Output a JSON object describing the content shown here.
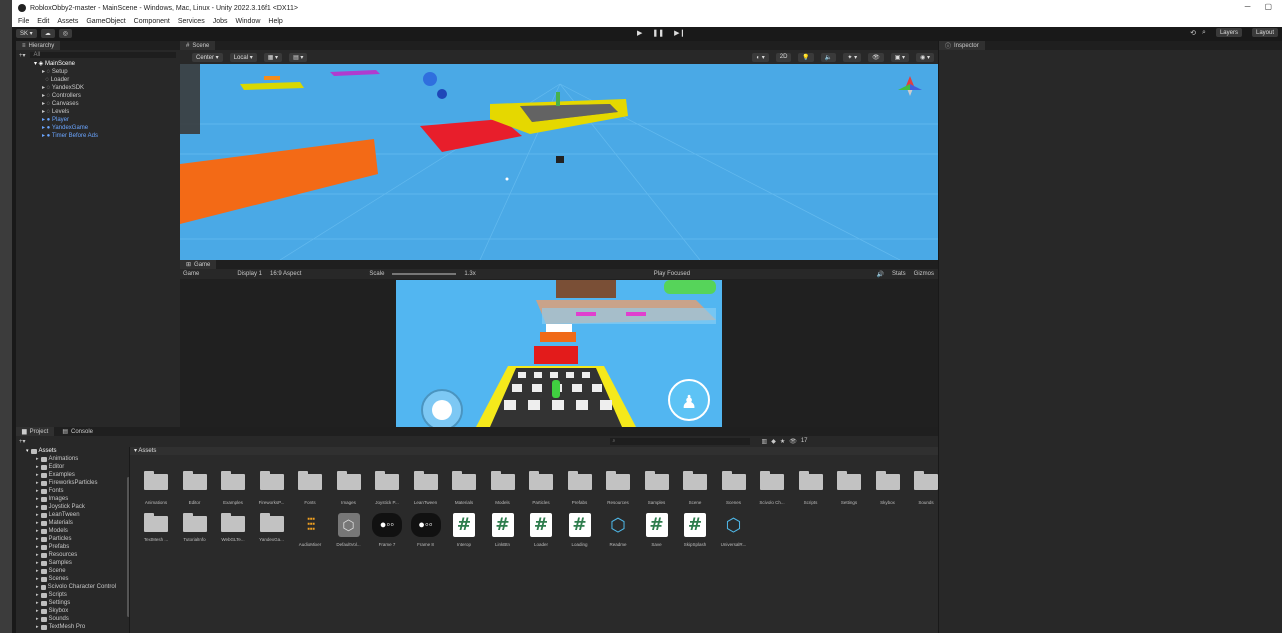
{
  "window": {
    "title": "RobloxObby2-master - MainScene - Windows, Mac, Linux - Unity 2022.3.16f1 <DX11>"
  },
  "menu": [
    "File",
    "Edit",
    "Assets",
    "GameObject",
    "Component",
    "Services",
    "Jobs",
    "Window",
    "Help"
  ],
  "toolbar": {
    "account": "SK ▾",
    "layers": "Layers",
    "layout": "Layout"
  },
  "hierarchy": {
    "tab": "Hierarchy",
    "search_placeholder": "All",
    "items": [
      {
        "label": "MainScene",
        "blue": false
      },
      {
        "label": "Setup",
        "blue": false
      },
      {
        "label": "Loader",
        "blue": false
      },
      {
        "label": "YandexSDK",
        "blue": false
      },
      {
        "label": "Controllers",
        "blue": false
      },
      {
        "label": "Canvases",
        "blue": false
      },
      {
        "label": "Levels",
        "blue": false
      },
      {
        "label": "Player",
        "blue": true
      },
      {
        "label": "YandexGame",
        "blue": true
      },
      {
        "label": "Timer Before Ads",
        "blue": true
      }
    ]
  },
  "scene": {
    "tab": "Scene",
    "pivot": "Center ▾",
    "space": "Local ▾",
    "persp": "< Persp",
    "mode2d": "2D"
  },
  "game": {
    "tab": "Game",
    "display": "Game",
    "display_num": "Display 1",
    "aspect": "16:9 Aspect",
    "scale_label": "Scale",
    "scale_value": "1.3x",
    "play_mode": "Play Focused",
    "stats": "Stats",
    "gizmos": "Gizmos"
  },
  "inspector": {
    "tab": "Inspector"
  },
  "project": {
    "tab": "Project",
    "console_tab": "Console",
    "breadcrumb": "Assets",
    "count": "17",
    "tree": [
      {
        "label": "Assets",
        "root": true
      },
      {
        "label": "Animations"
      },
      {
        "label": "Editor"
      },
      {
        "label": "Examples"
      },
      {
        "label": "FireworksParticles"
      },
      {
        "label": "Fonts"
      },
      {
        "label": "Images"
      },
      {
        "label": "Joystick Pack"
      },
      {
        "label": "LeanTween"
      },
      {
        "label": "Materials"
      },
      {
        "label": "Models"
      },
      {
        "label": "Particles"
      },
      {
        "label": "Prefabs"
      },
      {
        "label": "Resources"
      },
      {
        "label": "Samples"
      },
      {
        "label": "Scene"
      },
      {
        "label": "Scenes"
      },
      {
        "label": "Scivolo Character Control"
      },
      {
        "label": "Scripts"
      },
      {
        "label": "Settings"
      },
      {
        "label": "Skybox"
      },
      {
        "label": "Sounds"
      },
      {
        "label": "TextMesh Pro"
      }
    ],
    "assets_row1": [
      "Animations",
      "Editor",
      "Examples",
      "FireworksP...",
      "Fonts",
      "Images",
      "Joystick P...",
      "LeanTween",
      "Materials",
      "Models",
      "Particles",
      "Prefabs",
      "Resources",
      "Samples",
      "Scene",
      "Scenes",
      "Scivolo Ch...",
      "Scripts",
      "Settings",
      "Skybox",
      "Sounds"
    ],
    "assets_row2": [
      {
        "label": "TextMesh ...",
        "kind": "folder"
      },
      {
        "label": "TutorialInfo",
        "kind": "folder"
      },
      {
        "label": "WebGLTe...",
        "kind": "folder"
      },
      {
        "label": "YandexGa...",
        "kind": "folder"
      },
      {
        "label": "AudioMixer",
        "kind": "mixer"
      },
      {
        "label": "DefaultVol...",
        "kind": "volume"
      },
      {
        "label": "Frame 7",
        "kind": "image"
      },
      {
        "label": "Frame 8",
        "kind": "image"
      },
      {
        "label": "Interop",
        "kind": "script"
      },
      {
        "label": "LinkBtn",
        "kind": "script"
      },
      {
        "label": "Loader",
        "kind": "script"
      },
      {
        "label": "Loading",
        "kind": "script"
      },
      {
        "label": "Readme",
        "kind": "json"
      },
      {
        "label": "Save",
        "kind": "script"
      },
      {
        "label": "SkipSplash",
        "kind": "script"
      },
      {
        "label": "UniversalR...",
        "kind": "json"
      }
    ]
  }
}
